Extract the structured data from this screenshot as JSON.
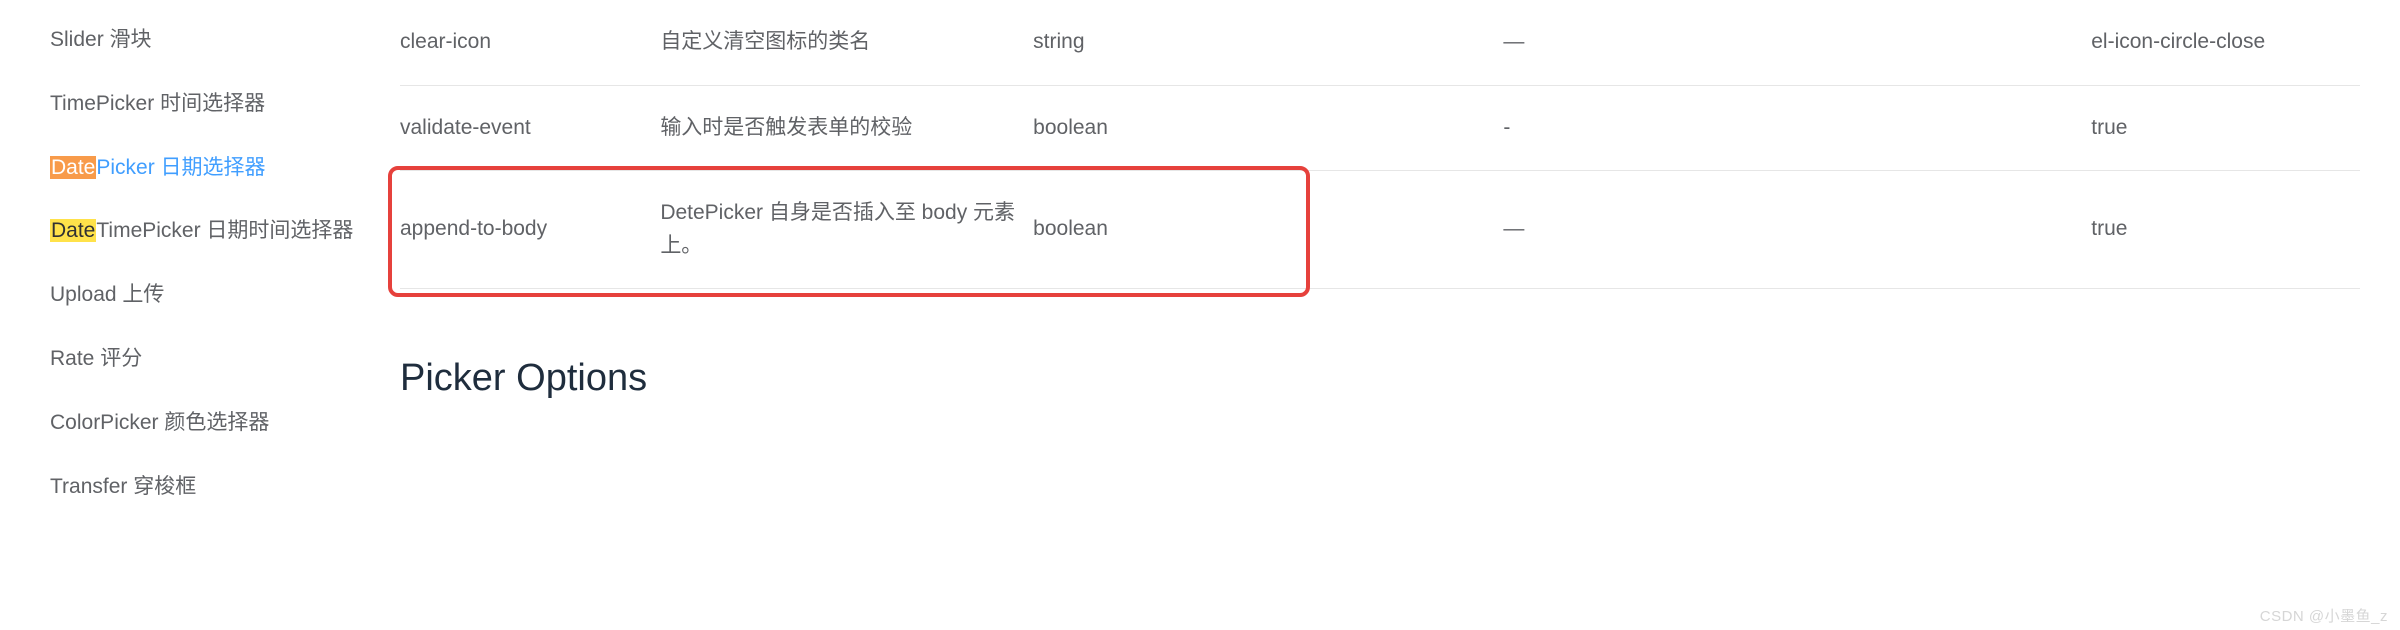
{
  "sidebar": {
    "items": [
      {
        "label": "Slider 滑块"
      },
      {
        "label": "TimePicker 时间选择器"
      },
      {
        "highlight_type": "orange",
        "highlight_text": "Date",
        "rest": "Picker 日期选择器",
        "active": true
      },
      {
        "highlight_type": "yellow",
        "highlight_text": "Date",
        "rest": "TimePicker 日期时间选择器"
      },
      {
        "label": "Upload 上传"
      },
      {
        "label": "Rate 评分"
      },
      {
        "label": "ColorPicker 颜色选择器"
      },
      {
        "label": "Transfer 穿梭框"
      }
    ]
  },
  "table": {
    "rows": [
      {
        "attr": "clear-icon",
        "desc": "自定义清空图标的类名",
        "type": "string",
        "options": "—",
        "default": "el-icon-circle-close"
      },
      {
        "attr": "validate-event",
        "desc": "输入时是否触发表单的校验",
        "type": "boolean",
        "options": "-",
        "default": "true"
      },
      {
        "attr": "append-to-body",
        "desc": "DetePicker 自身是否插入至 body 元素上。",
        "type": "boolean",
        "options": "—",
        "default": "true"
      }
    ]
  },
  "section_title": "Picker Options",
  "watermark": "CSDN @小墨鱼_z"
}
